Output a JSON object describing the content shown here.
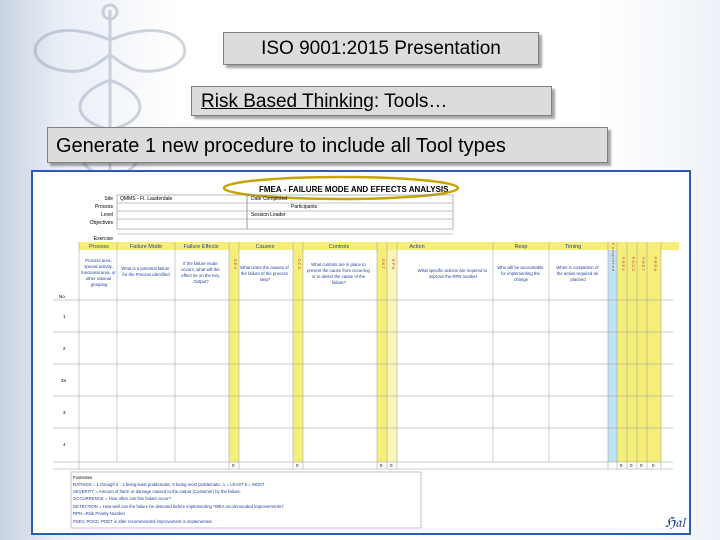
{
  "slide": {
    "title": "ISO 9001:2015 Presentation",
    "subtitle_underlined": "Risk Based Thinking",
    "subtitle_rest": ": Tools…",
    "instruction": "Generate 1 new procedure to include all Tool types"
  },
  "form": {
    "heading": "FMEA - FAILURE MODE AND EFFECTS ANALYSIS",
    "info_labels": [
      "Site",
      "Process",
      "Level",
      "Objectives",
      "Exercise"
    ],
    "site_value": "QMMS - Ft. Lauderdale",
    "right_labels": [
      "Date Completed",
      "Participants",
      "Session Leader"
    ],
    "col_headers": [
      "Process",
      "Failure Mode",
      "Failure Effects",
      "Causes",
      "Controls",
      "Action",
      "Resp",
      "Timing"
    ],
    "col_desc": {
      "process": [
        "Process area,",
        "special activity,",
        "functional area, or",
        "other rational",
        "grouping"
      ],
      "failure_mode": [
        "What is a potential failure",
        "for the Process identified"
      ],
      "failure_effects": [
        "If the failure mode",
        "occurs, what will the",
        "effect be on the Key",
        "Output?"
      ],
      "causes": [
        "What is/are the causes of",
        "the failure of the process",
        "step?"
      ],
      "controls": [
        "What controls are in place to",
        "prevent the cause from occurring",
        "or to detect the cause of the",
        "failure?"
      ],
      "action": [
        "What specific actions are required to",
        "improve the RPN number"
      ],
      "resp": [
        "Who will be accountable",
        "for implementing the",
        "change"
      ],
      "timing": [
        "When is completion of",
        "the action required as",
        "planned"
      ]
    },
    "small_cols": {
      "sev": "S E V",
      "occ": "O C C",
      "det": "D E T",
      "rpn": "R P N",
      "completed": "C o m p l e t e d",
      "psev": "P S E V",
      "pocc": "P O C C",
      "pdet": "P D E T",
      "prpn": "P R P N"
    },
    "no_label": "No",
    "row_numbers": [
      "1",
      "2",
      "3a",
      "3",
      "4"
    ],
    "total_zero": "0",
    "footnotes": [
      "Footnotes",
      "RATINGS = 1 through 5 - 1 being least problematic, 5 being most problematic.     1 = LEAST    5 = MOST",
      "SEVERITY = Amount of harm or damage caused to the output (Customer) by the failure.",
      "OCCURRENCE = How often can this failure occur?",
      "DETECTION = How well can the failure be detected before implementing *WEA recommended improvements?",
      "RPN =Risk Priority Number",
      "PSEV, POCC, PDET is after recommended improvement is implemented"
    ]
  },
  "logo_text": "ℌ𝔞𝔩"
}
